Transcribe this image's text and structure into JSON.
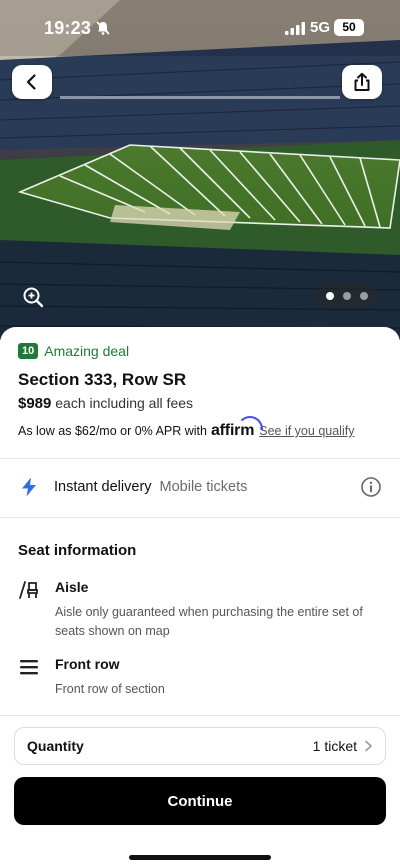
{
  "status_bar": {
    "time": "19:23",
    "network": "5G",
    "battery": "50"
  },
  "icons": {
    "back": "chevron-left-icon",
    "share": "share-icon",
    "zoom": "zoom-in-icon",
    "bolt": "lightning-bolt-icon",
    "info": "info-icon",
    "aisle": "aisle-seat-icon",
    "front_row": "front-row-icon",
    "chevron": "chevron-right-icon"
  },
  "gallery": {
    "page_count": 3,
    "current_page": 1
  },
  "deal": {
    "badge": "10",
    "text": "Amazing deal",
    "color": "#1f7a37"
  },
  "listing": {
    "section_row": "Section 333, Row SR",
    "price": "$989",
    "price_note": "each including all fees"
  },
  "financing": {
    "text": "As low as $62/mo or 0% APR with",
    "brand": "affirm",
    "link": "See if you qualify"
  },
  "delivery": {
    "label": "Instant delivery",
    "type": "Mobile tickets"
  },
  "seat_info": {
    "heading": "Seat information",
    "features": [
      {
        "title": "Aisle",
        "description": "Aisle only guaranteed when purchasing the entire set of seats shown on map"
      },
      {
        "title": "Front row",
        "description": "Front row of section"
      }
    ]
  },
  "quantity": {
    "label": "Quantity",
    "value": "1 ticket"
  },
  "cta": {
    "label": "Continue"
  },
  "colors": {
    "accent_bolt": "#2f6fe4",
    "affirm": "#4a4af4",
    "button": "#000000"
  }
}
